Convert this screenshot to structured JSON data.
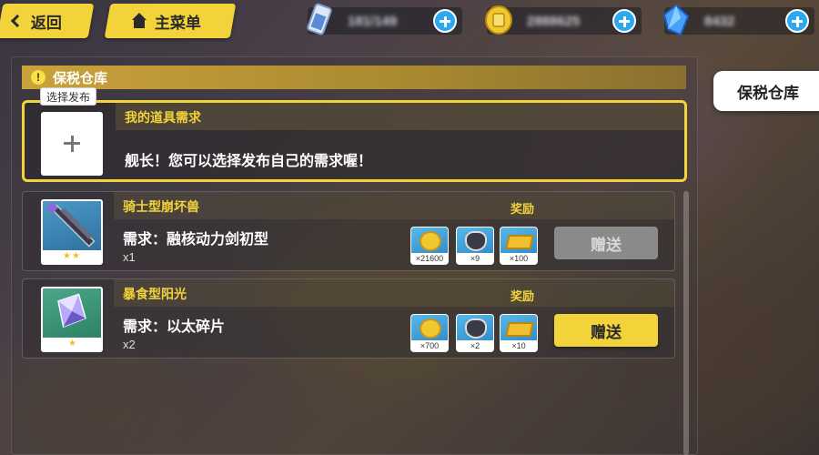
{
  "top_bar": {
    "back_label": "返回",
    "main_menu_label": "主菜单",
    "resources": [
      {
        "icon": "stamina-icon",
        "value": "181/149"
      },
      {
        "icon": "coin-icon",
        "value": "2888625"
      },
      {
        "icon": "crystal-icon",
        "value": "8432"
      }
    ]
  },
  "side_tab": {
    "label": "保税仓库"
  },
  "panel": {
    "title": "保税仓库",
    "my_request": {
      "publish_tag": "选择发布",
      "title": "我的道具需求",
      "description": "舰长！您可以选择发布自己的需求喔！"
    },
    "requests": [
      {
        "name": "骑士型崩坏兽",
        "need": "需求：融核动力剑初型",
        "qty": "x1",
        "reward_label": "奖励",
        "rewards": [
          {
            "icon": "coin-icon",
            "count": "×21600"
          },
          {
            "icon": "mask-icon",
            "count": "×9"
          },
          {
            "icon": "gold-bar-icon",
            "count": "×100"
          }
        ],
        "button": "赠送",
        "button_enabled": false
      },
      {
        "name": "暴食型阳光",
        "need": "需求：以太碎片",
        "qty": "x2",
        "reward_label": "奖励",
        "rewards": [
          {
            "icon": "coin-icon",
            "count": "×700"
          },
          {
            "icon": "mask-icon",
            "count": "×2"
          },
          {
            "icon": "gold-bar-icon",
            "count": "×10"
          }
        ],
        "button": "赠送",
        "button_enabled": true
      }
    ]
  },
  "colors": {
    "accent": "#f2d33a",
    "plus_button": "#2aa8f0"
  }
}
